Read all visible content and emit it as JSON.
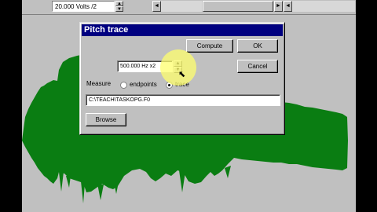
{
  "toolbar": {
    "scale_value": "20.000 Volts /2",
    "spin_up": "▲",
    "spin_down": "▼",
    "scroll_left": "◄",
    "scroll_right": "►"
  },
  "dialog": {
    "title": "Pitch trace",
    "compute_label": "Compute",
    "ok_label": "OK",
    "cancel_label": "Cancel",
    "frequency_value": "500.000 Hz x2",
    "spin_up": "▲",
    "spin_down": "▼",
    "measure_label": "Measure",
    "option_endpoints": "endpoints",
    "option_trace": "trace",
    "selected_option": "trace",
    "file_path": "C:\\TEACH\\TASKOPG.F0",
    "browse_label": "Browse"
  },
  "cursor_icon": "⬉",
  "colors": {
    "waveform": "#0a7d12",
    "dialog_title": "#000080",
    "highlight": "#ffff6e"
  }
}
